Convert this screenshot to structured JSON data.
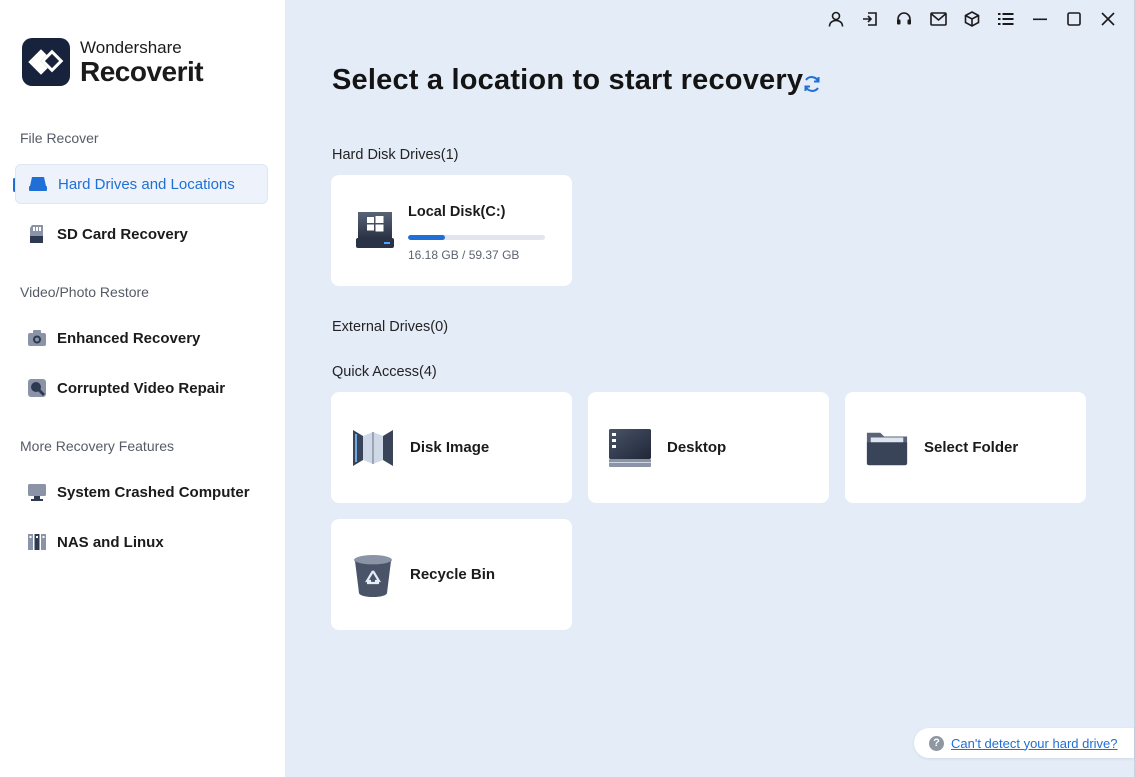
{
  "app": {
    "brand": "Wondershare",
    "product": "Recoverit"
  },
  "sidebar": {
    "sections": [
      {
        "title": "File Recover"
      },
      {
        "title": "Video/Photo Restore"
      },
      {
        "title": "More Recovery Features"
      }
    ],
    "items": [
      {
        "label": "Hard Drives and Locations",
        "icon": "hard-drive-icon",
        "active": true
      },
      {
        "label": "SD Card Recovery",
        "icon": "sd-card-icon"
      },
      {
        "label": "Enhanced Recovery",
        "icon": "camera-icon"
      },
      {
        "label": "Corrupted Video Repair",
        "icon": "video-repair-icon"
      },
      {
        "label": "System Crashed Computer",
        "icon": "monitor-icon"
      },
      {
        "label": "NAS and Linux",
        "icon": "nas-icon"
      }
    ]
  },
  "window_controls": [
    "account-icon",
    "sign-in-icon",
    "support-headset-icon",
    "mail-icon",
    "box-icon",
    "menu-list-icon",
    "minimize-icon",
    "maximize-icon",
    "close-icon"
  ],
  "main": {
    "title": "Select a location to start recovery",
    "hard_disk_label": "Hard Disk Drives(1)",
    "external_label": "External Drives(0)",
    "quick_access_label": "Quick Access(4)",
    "disk": {
      "name": "Local Disk(C:)",
      "used": "16.18 GB",
      "total": "59.37 GB",
      "size_text": "16.18 GB / 59.37 GB",
      "used_fraction": 0.2725
    },
    "quick_access": [
      {
        "label": "Disk Image",
        "icon": "disk-image-icon"
      },
      {
        "label": "Desktop",
        "icon": "desktop-icon"
      },
      {
        "label": "Select Folder",
        "icon": "folder-icon"
      },
      {
        "label": "Recycle Bin",
        "icon": "recycle-bin-icon"
      }
    ]
  },
  "help": {
    "link_text": "Can't detect your hard drive?"
  },
  "colors": {
    "accent": "#1f6fd6",
    "main_bg": "#e4ecf8",
    "logo_bg": "#17233d"
  }
}
